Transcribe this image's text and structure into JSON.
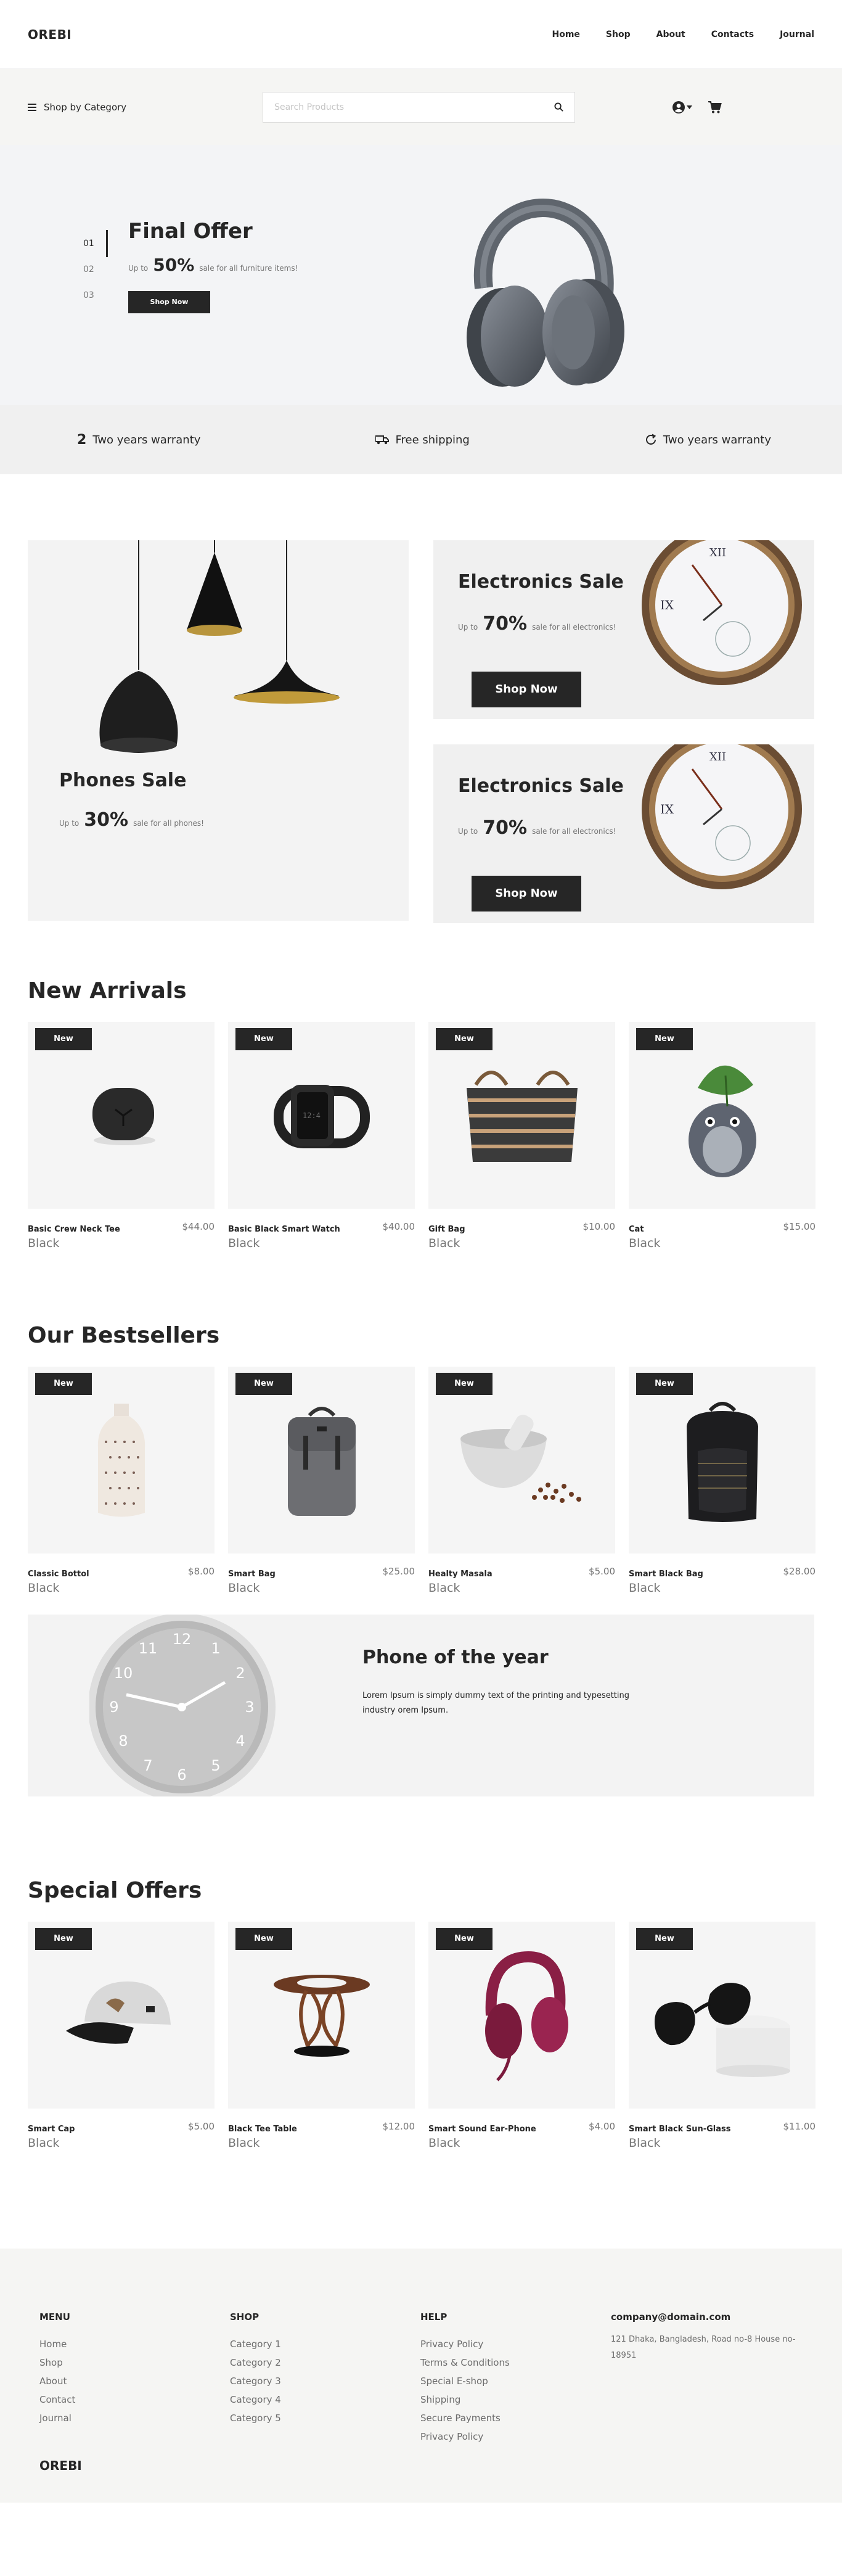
{
  "header": {
    "logo": "OREBI",
    "nav": [
      "Home",
      "Shop",
      "About",
      "Contacts",
      "Journal"
    ]
  },
  "searchbar": {
    "category_label": "Shop by Category",
    "placeholder": "Search Products",
    "icons": [
      "menu-icon",
      "search-icon",
      "user-icon",
      "caret-down-icon",
      "cart-icon"
    ]
  },
  "hero": {
    "slides": [
      "01",
      "02",
      "03"
    ],
    "active_slide": "01",
    "title": "Final Offer",
    "up_to": "Up to",
    "percent": "50%",
    "subtitle": "sale for all furniture items!",
    "button": "Shop Now"
  },
  "features": [
    {
      "icon": "number-2-icon",
      "num": "2",
      "label": "Two years warranty"
    },
    {
      "icon": "truck-icon",
      "num": "",
      "label": "Free shipping"
    },
    {
      "icon": "refresh-icon",
      "num": "",
      "label": "Two years warranty"
    }
  ],
  "promos": {
    "big": {
      "title": "Phones Sale",
      "up_to": "Up to",
      "percent": "30%",
      "subtitle": "sale for all phones!"
    },
    "small": [
      {
        "title": "Electronics Sale",
        "up_to": "Up to",
        "percent": "70%",
        "subtitle": "sale for all electronics!",
        "button": "Shop Now"
      },
      {
        "title": "Electronics Sale",
        "up_to": "Up to",
        "percent": "70%",
        "subtitle": "sale for all electronics!",
        "button": "Shop Now"
      }
    ]
  },
  "new_arrivals": {
    "title": "New Arrivals",
    "items": [
      {
        "badge": "New",
        "name": "Basic Crew Neck Tee",
        "price": "$44.00",
        "color": "Black"
      },
      {
        "badge": "New",
        "name": "Basic Black Smart Watch",
        "price": "$40.00",
        "color": "Black"
      },
      {
        "badge": "New",
        "name": "Gift Bag",
        "price": "$10.00",
        "color": "Black"
      },
      {
        "badge": "New",
        "name": "Cat",
        "price": "$15.00",
        "color": "Black"
      }
    ]
  },
  "bestsellers": {
    "title": "Our Bestsellers",
    "items": [
      {
        "badge": "New",
        "name": "Classic Bottol",
        "price": "$8.00",
        "color": "Black"
      },
      {
        "badge": "New",
        "name": "Smart Bag",
        "price": "$25.00",
        "color": "Black"
      },
      {
        "badge": "New",
        "name": "Healty Masala",
        "price": "$5.00",
        "color": "Black"
      },
      {
        "badge": "New",
        "name": "Smart Black Bag",
        "price": "$28.00",
        "color": "Black"
      }
    ]
  },
  "phone_of_year": {
    "title": "Phone of the year",
    "text": "Lorem Ipsum is simply dummy text of the printing and typesetting industry orem Ipsum.",
    "clock_numbers": [
      "12",
      "1",
      "2",
      "3",
      "4",
      "5",
      "6",
      "7",
      "8",
      "9",
      "10",
      "11"
    ]
  },
  "special_offers": {
    "title": "Special Offers",
    "items": [
      {
        "badge": "New",
        "name": "Smart Cap",
        "price": "$5.00",
        "color": "Black"
      },
      {
        "badge": "New",
        "name": "Black Tee Table",
        "price": "$12.00",
        "color": "Black"
      },
      {
        "badge": "New",
        "name": "Smart Sound Ear-Phone",
        "price": "$4.00",
        "color": "Black"
      },
      {
        "badge": "New",
        "name": "Smart Black Sun-Glass",
        "price": "$11.00",
        "color": "Black"
      }
    ]
  },
  "footer": {
    "menu": {
      "title": "MENU",
      "links": [
        "Home",
        "Shop",
        "About",
        "Contact",
        "Journal"
      ]
    },
    "shop": {
      "title": "SHOP",
      "links": [
        "Category 1",
        "Category 2",
        "Category 3",
        "Category 4",
        "Category 5"
      ]
    },
    "help": {
      "title": "HELP",
      "links": [
        "Privacy Policy",
        "Terms & Conditions",
        "Special E-shop",
        "Shipping",
        "Secure Payments",
        "Privacy Policy"
      ]
    },
    "contact": {
      "email": "company@domain.com",
      "address": "121 Dhaka, Bangladesh, Road no-8 House no-18951"
    },
    "logo": "OREBI"
  },
  "colors": {
    "primary": "#262626",
    "muted": "#767676",
    "bg_light": "#f5f5f3"
  }
}
